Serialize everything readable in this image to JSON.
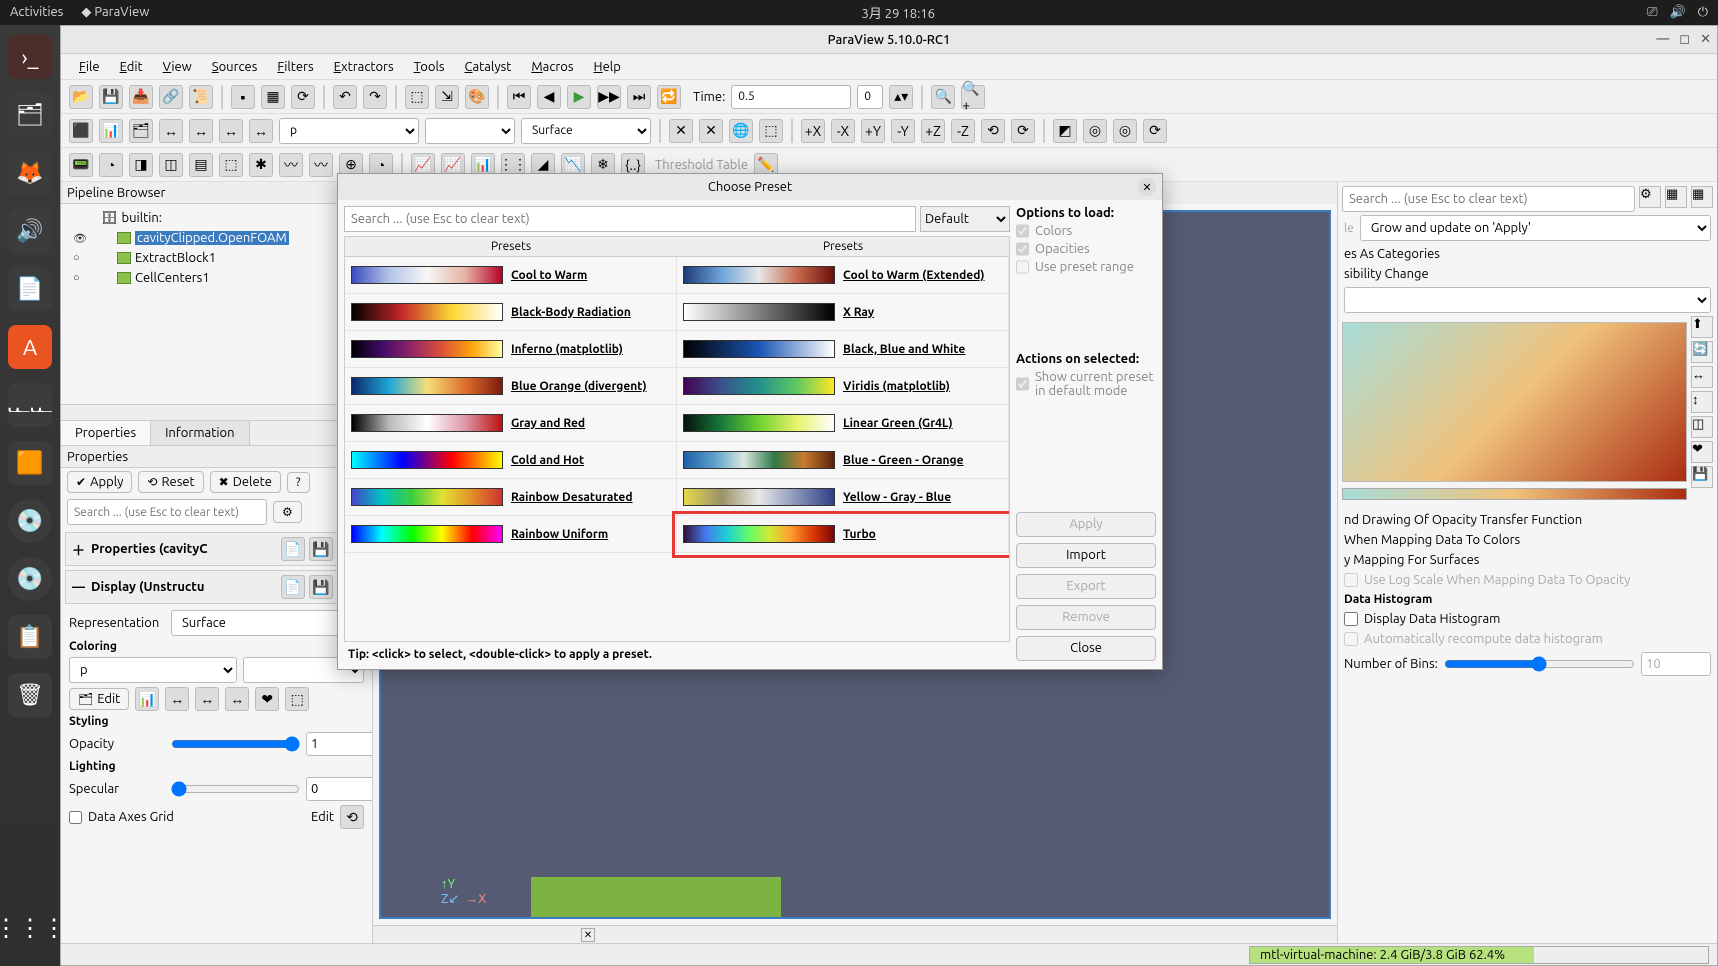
{
  "gnome": {
    "activities": "Activities",
    "app": "ParaView",
    "clock": "3月 29  18:16"
  },
  "pv_title": "ParaView 5.10.0-RC1",
  "menu": [
    "File",
    "Edit",
    "View",
    "Sources",
    "Filters",
    "Extractors",
    "Tools",
    "Catalyst",
    "Macros",
    "Help"
  ],
  "time_label": "Time:",
  "time_value": "0.5",
  "time_index": "0",
  "array_select": "p",
  "repr_select": "Surface",
  "threshold_label": "Threshold Table",
  "pipeline": {
    "title": "Pipeline Browser",
    "builtin": "builtin:",
    "items": [
      "cavityClipped.OpenFOAM",
      "ExtractBlock1",
      "CellCenters1"
    ]
  },
  "tabs": {
    "properties": "Properties",
    "information": "Information"
  },
  "props": {
    "title": "Properties",
    "apply": "Apply",
    "reset": "Reset",
    "delete": "Delete",
    "search_ph": "Search ... (use Esc to clear text)",
    "sec1": "Properties (cavityC",
    "sec2": "Display (Unstructu",
    "representation": "Representation",
    "repr_val": "Surface",
    "coloring": "Coloring",
    "color_val": "p",
    "edit": "Edit",
    "styling": "Styling",
    "opacity": "Opacity",
    "opacity_val": "1",
    "lighting": "Lighting",
    "specular": "Specular",
    "specular_val": "0",
    "data_axes": "Data Axes Grid",
    "data_axes_edit": "Edit"
  },
  "right": {
    "search_ph": "Search ... (use Esc to clear text)",
    "grow_lbl": "Grow and update on 'Apply'",
    "cats": "es As Categories",
    "vischg": "sibility Change",
    "opacity_tf": "nd Drawing Of Opacity Transfer Function",
    "mapcolors": "When Mapping Data To Colors",
    "mapsurf": "y Mapping For Surfaces",
    "logscale": "Use Log Scale When Mapping Data To Opacity",
    "hist_hdr": "Data Histogram",
    "disphist": "Display Data Histogram",
    "autohist": "Automatically recompute data histogram",
    "bins_lbl": "Number of Bins:",
    "bins_val": "10"
  },
  "status_mem": "mtl-virtual-machine: 2.4 GiB/3.8 GiB 62.4%",
  "modal": {
    "title": "Choose Preset",
    "search_ph": "Search ... (use Esc to clear text)",
    "default": "Default",
    "col_hdr": "Presets",
    "options_hdr": "Options to load:",
    "opt_colors": "Colors",
    "opt_opac": "Opacities",
    "opt_range": "Use preset range",
    "actions_hdr": "Actions on selected:",
    "show_default": "Show current preset in default mode",
    "btn_apply": "Apply",
    "btn_import": "Import",
    "btn_export": "Export",
    "btn_remove": "Remove",
    "btn_close": "Close",
    "tip": "Tip: <click> to select, <double-click> to apply a preset.",
    "presets_left": [
      "Cool to Warm",
      "Black-Body Radiation",
      "Inferno (matplotlib)",
      "Blue Orange (divergent)",
      "Gray and Red",
      "Cold and Hot",
      "Rainbow Desaturated",
      "Rainbow Uniform"
    ],
    "presets_right": [
      "Cool to Warm (Extended)",
      "X Ray",
      "Black, Blue and White",
      "Viridis (matplotlib)",
      "Linear Green (Gr4L)",
      "Blue - Green - Orange",
      "Yellow - Gray - Blue",
      "Turbo"
    ]
  }
}
